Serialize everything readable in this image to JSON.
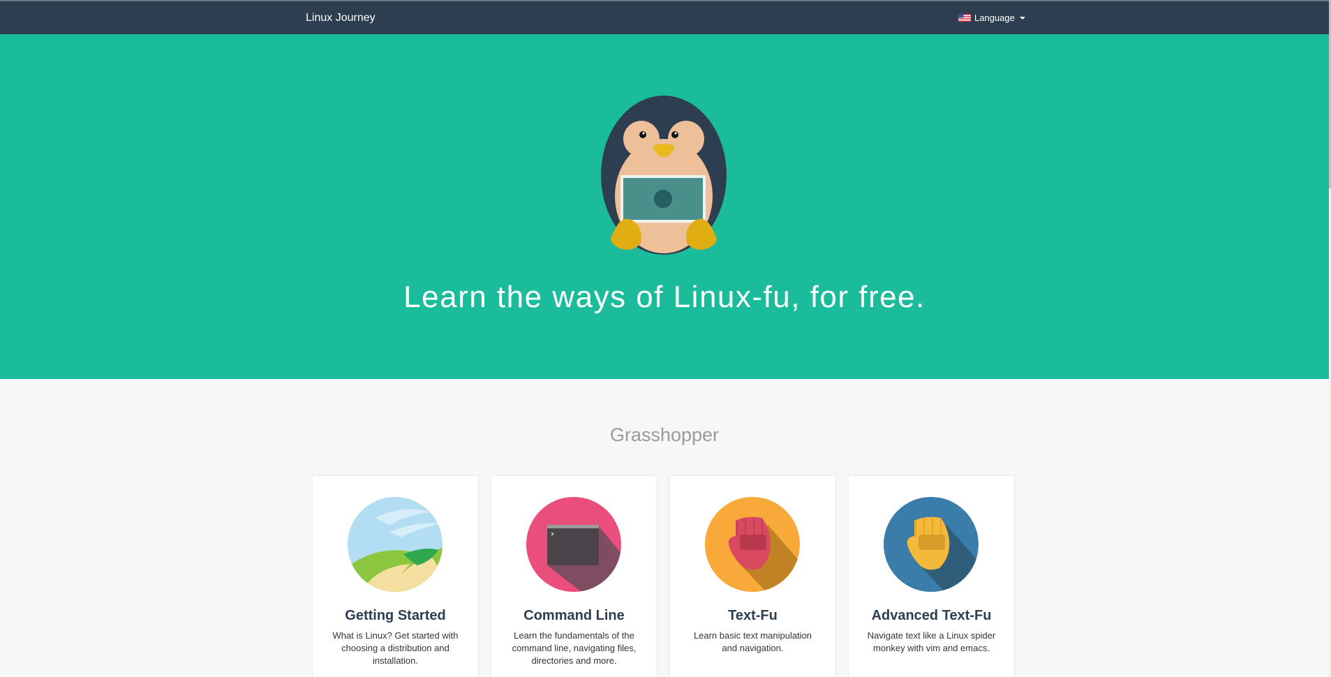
{
  "navbar": {
    "brand": "Linux Journey",
    "language_label": "Language"
  },
  "hero": {
    "headline": "Learn the ways of Linux-fu, for free."
  },
  "section": {
    "title": "Grasshopper"
  },
  "cards": [
    {
      "title": "Getting Started",
      "description": "What is Linux? Get started with choosing a distribution and installation.",
      "icon": "landscape-icon"
    },
    {
      "title": "Command Line",
      "description": "Learn the fundamentals of the command line, navigating files, directories and more.",
      "icon": "terminal-icon"
    },
    {
      "title": "Text-Fu",
      "description": "Learn basic text manipulation and navigation.",
      "icon": "red-glove-icon"
    },
    {
      "title": "Advanced Text-Fu",
      "description": "Navigate text like a Linux spider monkey with vim and emacs.",
      "icon": "yellow-glove-icon"
    }
  ],
  "colors": {
    "navbar": "#2c3e50",
    "hero": "#1bbc9b",
    "background": "#f7f7f7",
    "card_title": "#2c3e50"
  }
}
